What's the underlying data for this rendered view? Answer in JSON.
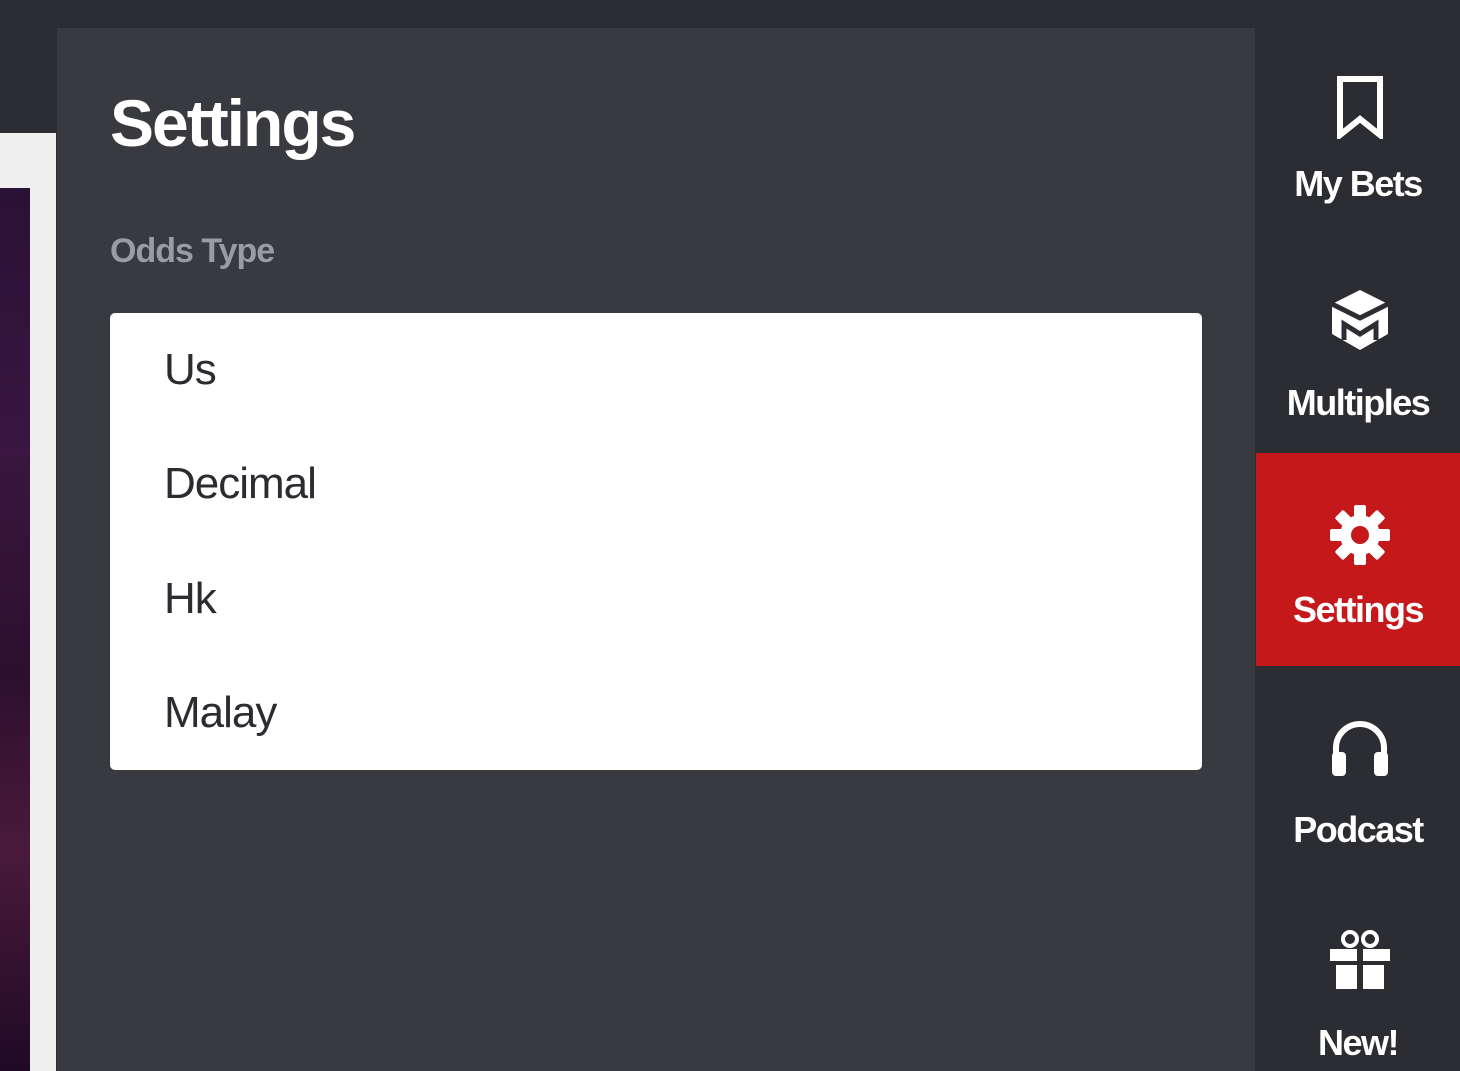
{
  "settings": {
    "title": "Settings",
    "odds_type_label": "Odds Type",
    "odds_options": [
      "Us",
      "Decimal",
      "Hk",
      "Malay"
    ]
  },
  "nav": {
    "items": [
      {
        "label": "My Bets",
        "icon": "bookmark-icon"
      },
      {
        "label": "Multiples",
        "icon": "multiples-cube-icon"
      },
      {
        "label": "Settings",
        "icon": "gear-icon",
        "active": true
      },
      {
        "label": "Podcast",
        "icon": "headphones-icon"
      },
      {
        "label": "New!",
        "icon": "gift-icon"
      }
    ]
  },
  "colors": {
    "panel_bg": "#383a40",
    "rail_bg": "#2b2d33",
    "active_accent": "#c4181b",
    "label_muted": "#9a9ca1"
  }
}
